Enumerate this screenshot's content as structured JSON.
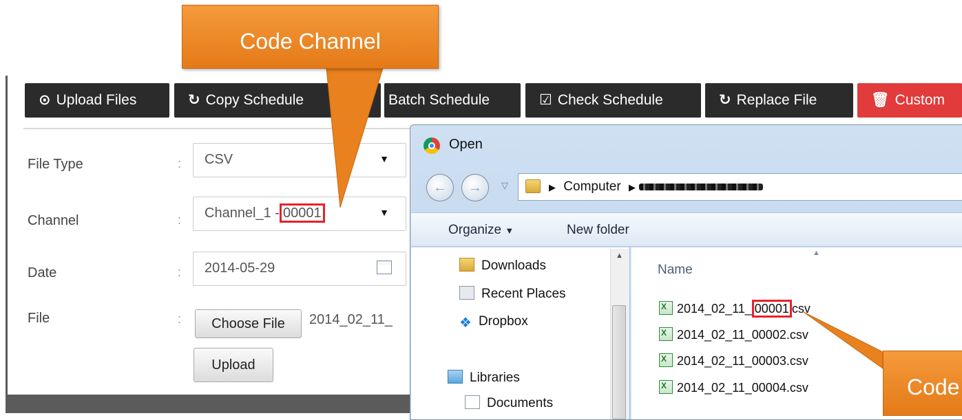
{
  "toolbar": {
    "buttons": [
      {
        "label": "Upload Files",
        "icon": "upload-circle-icon",
        "glyph": "⊙"
      },
      {
        "label": "Copy Schedule",
        "icon": "copy-icon",
        "glyph": "↻"
      },
      {
        "label": "Batch Schedule",
        "icon": "batch-icon",
        "glyph": ""
      },
      {
        "label": "Check Schedule",
        "icon": "check-square-icon",
        "glyph": "☑"
      },
      {
        "label": "Replace File",
        "icon": "refresh-icon",
        "glyph": "↻"
      },
      {
        "label": "Custom",
        "icon": "trash-icon",
        "glyph": "🗑",
        "color": "#e13b3b"
      }
    ]
  },
  "form": {
    "file_type": {
      "label": "File Type",
      "value": "CSV"
    },
    "channel": {
      "label": "Channel",
      "value_prefix": "Channel_1 -",
      "value_code": "00001"
    },
    "date": {
      "label": "Date",
      "value": "2014-05-29"
    },
    "file": {
      "label": "File",
      "button": "Choose File",
      "filename": "2014_02_11_"
    },
    "upload_button": "Upload"
  },
  "callouts": {
    "main": "Code Channel",
    "secondary": "Code"
  },
  "dialog": {
    "title": "Open",
    "breadcrumb": "Computer",
    "organize": "Organize",
    "new_folder": "New folder",
    "nav_items": [
      "Downloads",
      "Recent Places",
      "Dropbox",
      "Libraries",
      "Documents"
    ],
    "column_header": "Name",
    "files": [
      {
        "prefix": "2014_02_11_",
        "code": "00001",
        "ext": "csv",
        "highlight": true
      },
      {
        "name": "2014_02_11_00002.csv"
      },
      {
        "name": "2014_02_11_00003.csv"
      },
      {
        "name": "2014_02_11_00004.csv"
      }
    ]
  },
  "colors": {
    "callout": "#f0892a",
    "highlight": "#e8202a",
    "toolbar_bg": "#2b2b2b",
    "danger": "#e13b3b"
  }
}
